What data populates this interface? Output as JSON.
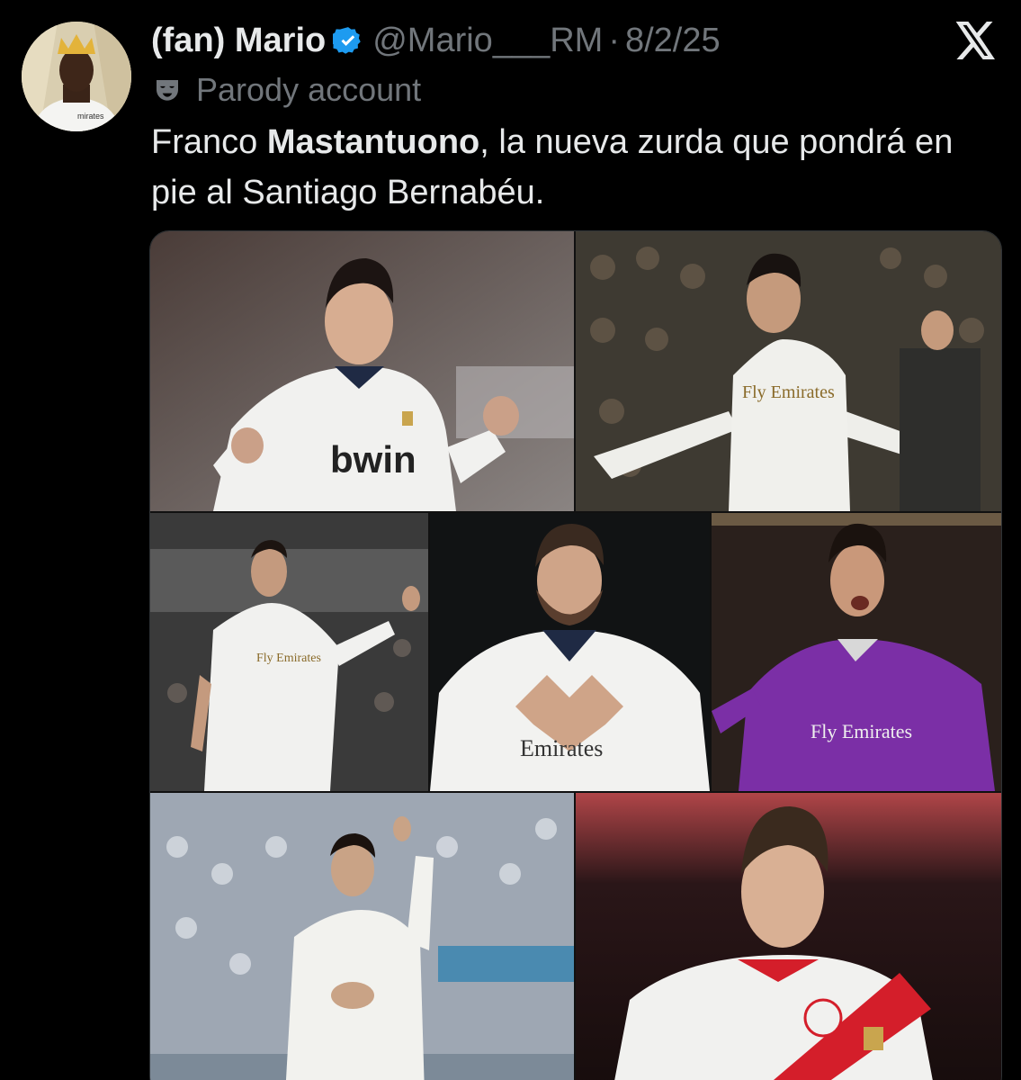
{
  "tweet": {
    "display_name": "(fan) Mario",
    "handle": "@Mario___RM",
    "separator": "·",
    "date": "8/2/25",
    "label": "Parody account",
    "text_pre": "Franco ",
    "text_bold": "Mastantuono",
    "text_post": ", la nueva zurda que pondrá en pie al Santiago Bernabéu."
  },
  "icons": {
    "verified": "verified-badge-icon",
    "parody": "theater-mask-icon",
    "platform": "x-logo-icon"
  },
  "colors": {
    "background": "#000000",
    "text_primary": "#e7e9ea",
    "text_secondary": "#71767b",
    "verified_blue": "#1d9bf0"
  },
  "media": {
    "photos": [
      {
        "shirt_sponsor": "bwin"
      },
      {
        "shirt_sponsor": "Fly Emirates"
      },
      {
        "shirt_sponsor": "Fly Emirates"
      },
      {
        "shirt_sponsor": "Emirates"
      },
      {
        "shirt_sponsor": "Fly Emirates"
      },
      {
        "shirt_sponsor": ""
      },
      {
        "shirt_sponsor": ""
      }
    ]
  }
}
